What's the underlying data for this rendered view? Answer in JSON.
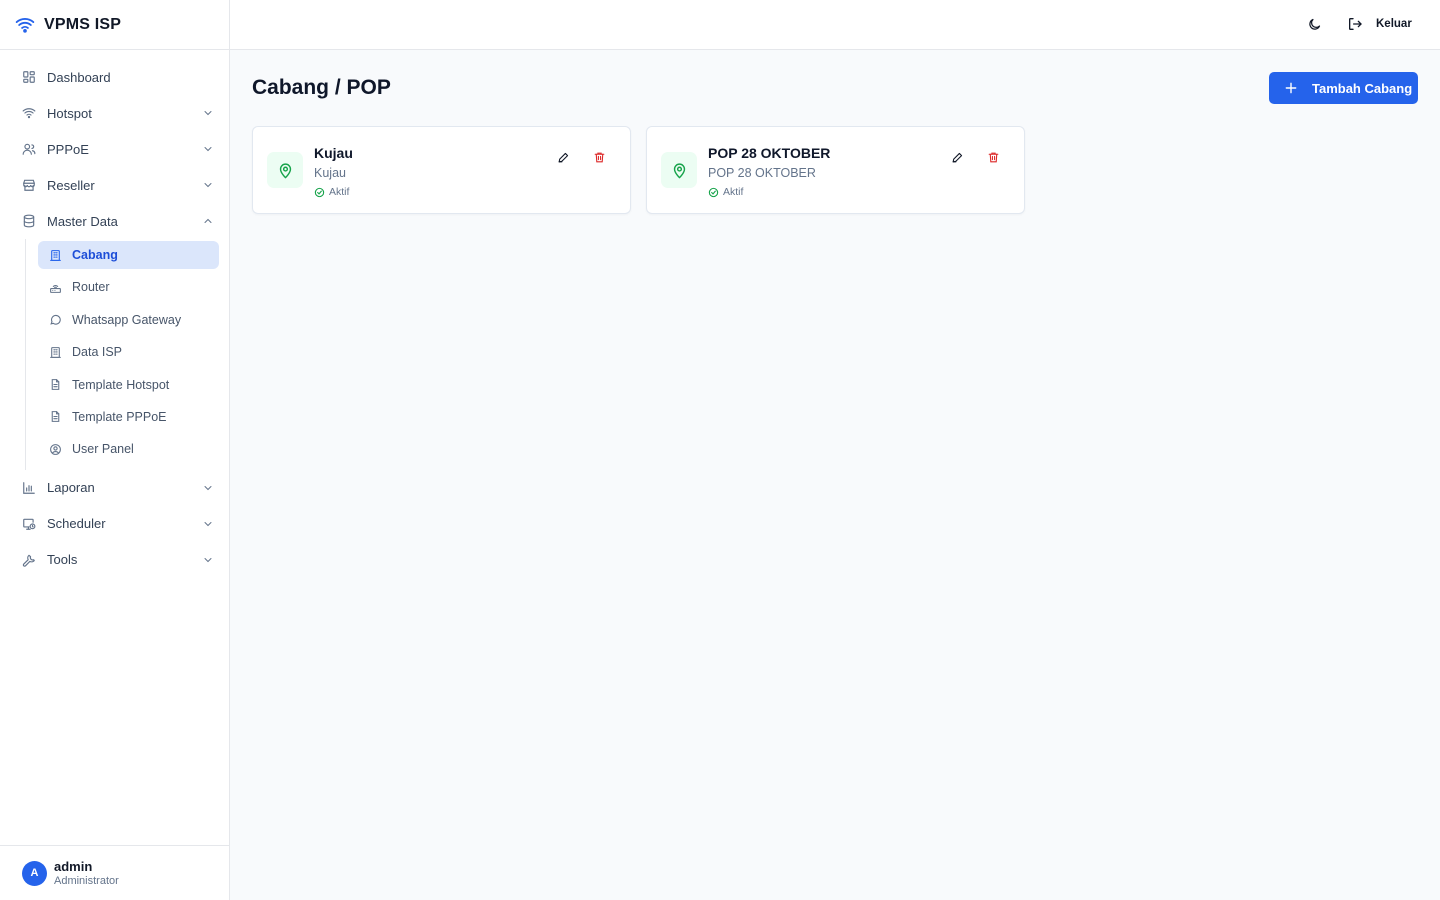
{
  "app": {
    "name": "VPMS ISP"
  },
  "topbar": {
    "logout_label": "Keluar"
  },
  "sidebar": {
    "items": [
      {
        "label": "Dashboard",
        "icon": "dashboard-icon"
      },
      {
        "label": "Hotspot",
        "icon": "wifi-icon"
      },
      {
        "label": "PPPoE",
        "icon": "users-icon"
      },
      {
        "label": "Reseller",
        "icon": "store-icon"
      },
      {
        "label": "Master Data",
        "icon": "database-icon"
      },
      {
        "label": "Laporan",
        "icon": "bar-chart-icon"
      },
      {
        "label": "Scheduler",
        "icon": "monitor-clock-icon"
      },
      {
        "label": "Tools",
        "icon": "wrench-icon"
      }
    ],
    "master_data": [
      {
        "label": "Cabang",
        "icon": "building-icon",
        "active": true
      },
      {
        "label": "Router",
        "icon": "router-icon"
      },
      {
        "label": "Whatsapp Gateway",
        "icon": "chat-icon"
      },
      {
        "label": "Data ISP",
        "icon": "building-icon"
      },
      {
        "label": "Template Hotspot",
        "icon": "file-icon"
      },
      {
        "label": "Template PPPoE",
        "icon": "file-icon"
      },
      {
        "label": "User Panel",
        "icon": "user-circle-icon"
      }
    ]
  },
  "user": {
    "initial": "A",
    "name": "admin",
    "role": "Administrator"
  },
  "main": {
    "title": "Cabang / POP",
    "add_button": "Tambah Cabang",
    "branches": [
      {
        "name": "Kujau",
        "subtitle": "Kujau",
        "status": "Aktif"
      },
      {
        "name": "POP 28 OKTOBER",
        "subtitle": "POP 28 OKTOBER",
        "status": "Aktif"
      }
    ]
  },
  "colors": {
    "accent": "#2563eb",
    "active_bg": "#dbe6fb",
    "success": "#16a34a",
    "danger": "#dc2626"
  }
}
